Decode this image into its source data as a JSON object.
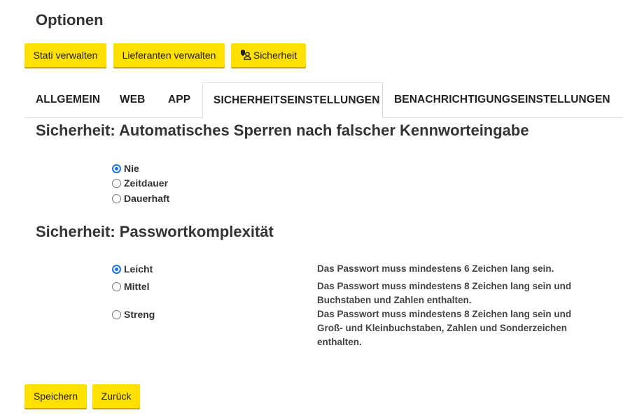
{
  "page": {
    "title": "Optionen"
  },
  "toolbar": {
    "stati_label": "Stati verwalten",
    "lieferanten_label": "Lieferanten verwalten",
    "sicherheit_label": "Sicherheit"
  },
  "tabs": [
    {
      "label": "ALLGEMEIN",
      "active": false
    },
    {
      "label": "WEB",
      "active": false
    },
    {
      "label": "APP",
      "active": false
    },
    {
      "label": "SICHERHEITSEINSTELLUNGEN",
      "active": true
    },
    {
      "label": "BENACHRICHTIGUNGSEINSTELLUNGEN",
      "active": false
    }
  ],
  "lockout": {
    "title": "Sicherheit: Automatisches Sperren nach falscher Kennworteingabe",
    "options": [
      {
        "label": "Nie",
        "checked": true
      },
      {
        "label": "Zeitdauer",
        "checked": false
      },
      {
        "label": "Dauerhaft",
        "checked": false
      }
    ]
  },
  "complexity": {
    "title": "Sicherheit: Passwortkomplexität",
    "options": [
      {
        "label": "Leicht",
        "checked": true,
        "desc": "Das Passwort muss mindestens 6 Zeichen lang sein."
      },
      {
        "label": "Mittel",
        "checked": false,
        "desc": "Das Passwort muss mindestens 8 Zeichen lang sein und Buchstaben und Zahlen enthalten."
      },
      {
        "label": "Streng",
        "checked": false,
        "desc": "Das Passwort muss mindestens 8 Zeichen lang sein und Groß- und Kleinbuchstaben, Zahlen und Sonderzeichen enthalten."
      }
    ]
  },
  "footer": {
    "save_label": "Speichern",
    "back_label": "Zurück"
  },
  "colors": {
    "accent": "#ffe000",
    "radio": "#1a73e8"
  },
  "icons": {
    "sicherheit": "user-shield-icon"
  }
}
